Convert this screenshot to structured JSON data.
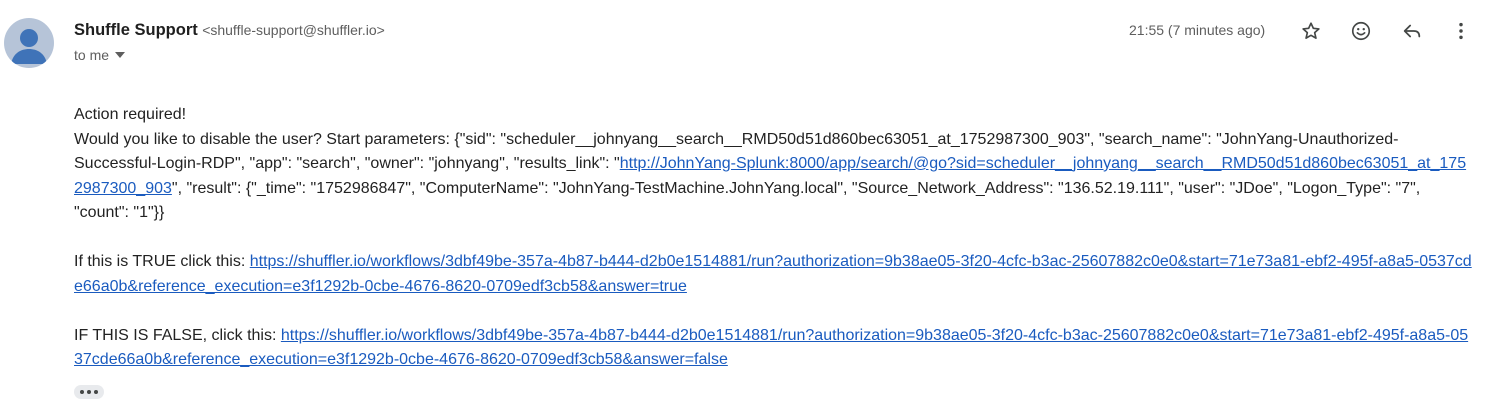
{
  "sender": {
    "name": "Shuffle Support",
    "email": "<shuffle-support@shuffler.io>",
    "avatar_icon": "person-avatar-icon"
  },
  "recipient": {
    "label": "to me"
  },
  "timestamp": "21:55 (7 minutes ago)",
  "toolbar": {
    "star_icon": "star-icon",
    "emoji_icon": "emoji-react-icon",
    "reply_icon": "reply-icon",
    "more_icon": "more-vert-icon"
  },
  "body": {
    "heading": "Action required!",
    "intro": "Would you like to disable the user? Start parameters: {\"sid\": \"scheduler__johnyang__search__RMD50d51d860bec63051_at_1752987300_903\", \"search_name\": \"JohnYang-Unauthorized-Successful-Login-RDP\", \"app\": \"search\", \"owner\": \"johnyang\", \"results_link\": \"",
    "results_link": "http://JohnYang-Splunk:8000/app/search/@go?sid=scheduler__johnyang__search__RMD50d51d860bec63051_at_1752987300_903",
    "intro_tail": "\", \"result\": {\"_time\": \"1752986847\", \"ComputerName\": \"JohnYang-TestMachine.JohnYang.local\", \"Source_Network_Address\": \"136.52.19.111\", \"user\": \"JDoe\", \"Logon_Type\": \"7\", \"count\": \"1\"}}",
    "true_prefix": "If this is TRUE click this: ",
    "true_link": "https://shuffler.io/workflows/3dbf49be-357a-4b87-b444-d2b0e1514881/run?authorization=9b38ae05-3f20-4cfc-b3ac-25607882c0e0&start=71e73a81-ebf2-495f-a8a5-0537cde66a0b&reference_execution=e3f1292b-0cbe-4676-8620-0709edf3cb58&answer=true",
    "false_prefix": "IF THIS IS FALSE, click this: ",
    "false_link": "https://shuffler.io/workflows/3dbf49be-357a-4b87-b444-d2b0e1514881/run?authorization=9b38ae05-3f20-4cfc-b3ac-25607882c0e0&start=71e73a81-ebf2-495f-a8a5-0537cde66a0b&reference_execution=e3f1292b-0cbe-4676-8620-0709edf3cb58&answer=false"
  },
  "colors": {
    "link": "#1a5bbf",
    "avatar_bg": "#b6c4d8",
    "avatar_fg": "#3f73b8"
  }
}
